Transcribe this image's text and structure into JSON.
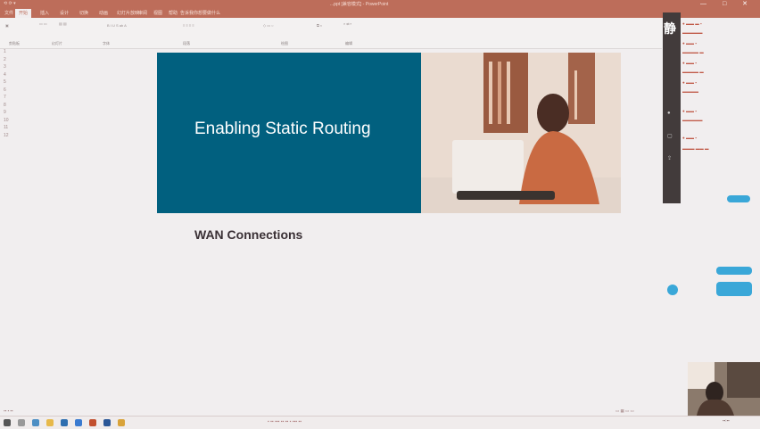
{
  "window": {
    "title": "...ppt [兼容模式] - PowerPoint",
    "controls": [
      "—",
      "□",
      "✕"
    ]
  },
  "menu": {
    "tabs": [
      "文件",
      "开始",
      "插入",
      "设计",
      "切换",
      "动画",
      "幻灯片放映",
      "审阅",
      "视图",
      "帮助",
      "告诉我你想要做什么"
    ],
    "active_index": 1
  },
  "ribbon": {
    "groups": [
      "剪贴板",
      "幻灯片",
      "字体",
      "段落",
      "绘图",
      "编辑"
    ]
  },
  "thumbnails": [
    "1",
    "2",
    "3",
    "4",
    "5",
    "6",
    "7",
    "8",
    "9",
    "10",
    "11",
    "12"
  ],
  "slide": {
    "title": "Enabling Static Routing",
    "subtitle": "WAN Connections"
  },
  "side_panel": {
    "label": "静"
  },
  "taskbar": {
    "icons": [
      "start-icon",
      "search-icon",
      "edge-icon",
      "explorer-icon",
      "store-icon",
      "mail-icon",
      "powerpoint-icon",
      "word-icon",
      "chrome-icon"
    ]
  },
  "colors": {
    "titlebar": "#bd6d5a",
    "slide_blue": "#01607f",
    "chat_bubble": "#3aa7d8"
  }
}
